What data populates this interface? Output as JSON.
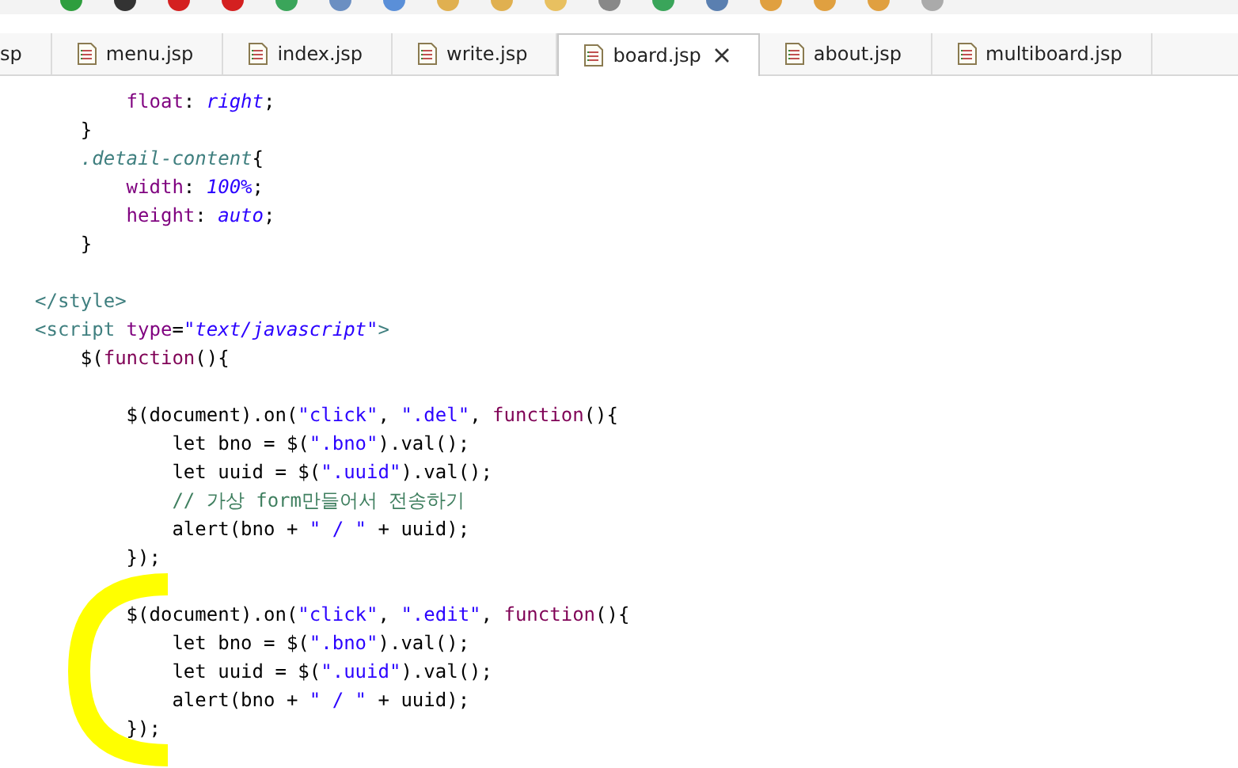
{
  "tabs": [
    {
      "label": "sp",
      "selected": false
    },
    {
      "label": "menu.jsp",
      "selected": false
    },
    {
      "label": "index.jsp",
      "selected": false
    },
    {
      "label": "write.jsp",
      "selected": false
    },
    {
      "label": "board.jsp",
      "selected": true
    },
    {
      "label": "about.jsp",
      "selected": false
    },
    {
      "label": "multiboard.jsp",
      "selected": false
    }
  ],
  "code_lines": [
    {
      "kind": "code",
      "tokens": [
        {
          "kind": "property",
          "text": "        float"
        },
        {
          "kind": "plain",
          "text": ": "
        },
        {
          "kind": "value",
          "text": "right"
        },
        {
          "kind": "plain",
          "text": ";"
        }
      ]
    },
    {
      "kind": "code",
      "tokens": [
        {
          "kind": "plain",
          "text": "    }"
        }
      ]
    },
    {
      "kind": "code",
      "tokens": [
        {
          "kind": "selector",
          "text": "    .detail-content"
        },
        {
          "kind": "plain",
          "text": "{"
        }
      ]
    },
    {
      "kind": "code",
      "tokens": [
        {
          "kind": "property",
          "text": "        width"
        },
        {
          "kind": "plain",
          "text": ": "
        },
        {
          "kind": "value",
          "text": "100%"
        },
        {
          "kind": "plain",
          "text": ";"
        }
      ]
    },
    {
      "kind": "code",
      "tokens": [
        {
          "kind": "property",
          "text": "        height"
        },
        {
          "kind": "plain",
          "text": ": "
        },
        {
          "kind": "value",
          "text": "auto"
        },
        {
          "kind": "plain",
          "text": ";"
        }
      ]
    },
    {
      "kind": "code",
      "tokens": [
        {
          "kind": "plain",
          "text": "    }"
        }
      ]
    },
    {
      "kind": "blank"
    },
    {
      "kind": "code",
      "tokens": [
        {
          "kind": "tag",
          "text": "</style>"
        }
      ]
    },
    {
      "kind": "code",
      "tokens": [
        {
          "kind": "tag",
          "text": "<script "
        },
        {
          "kind": "attribute",
          "text": "type"
        },
        {
          "kind": "plain",
          "text": "="
        },
        {
          "kind": "value",
          "text": "\"text/javascript\""
        },
        {
          "kind": "tag",
          "text": ">"
        }
      ]
    },
    {
      "kind": "code",
      "tokens": [
        {
          "kind": "plain",
          "text": "    $("
        },
        {
          "kind": "keyword",
          "text": "function"
        },
        {
          "kind": "plain",
          "text": "(){"
        }
      ]
    },
    {
      "kind": "blank"
    },
    {
      "kind": "code",
      "tokens": [
        {
          "kind": "plain",
          "text": "        $(document).on("
        },
        {
          "kind": "string",
          "text": "\"click\""
        },
        {
          "kind": "plain",
          "text": ", "
        },
        {
          "kind": "string",
          "text": "\".del\""
        },
        {
          "kind": "plain",
          "text": ", "
        },
        {
          "kind": "keyword",
          "text": "function"
        },
        {
          "kind": "plain",
          "text": "(){"
        }
      ]
    },
    {
      "kind": "code",
      "tokens": [
        {
          "kind": "plain",
          "text": "            let bno = $("
        },
        {
          "kind": "string",
          "text": "\".bno\""
        },
        {
          "kind": "plain",
          "text": ").val();"
        }
      ]
    },
    {
      "kind": "code",
      "tokens": [
        {
          "kind": "plain",
          "text": "            let uuid = $("
        },
        {
          "kind": "string",
          "text": "\".uuid\""
        },
        {
          "kind": "plain",
          "text": ").val();"
        }
      ]
    },
    {
      "kind": "code",
      "tokens": [
        {
          "kind": "comment",
          "text": "            // 가상 form만들어서 전송하기"
        }
      ]
    },
    {
      "kind": "code",
      "tokens": [
        {
          "kind": "plain",
          "text": "            alert(bno + "
        },
        {
          "kind": "string",
          "text": "\" / \""
        },
        {
          "kind": "plain",
          "text": " + uuid);"
        }
      ]
    },
    {
      "kind": "code",
      "tokens": [
        {
          "kind": "plain",
          "text": "        });"
        }
      ]
    },
    {
      "kind": "blank"
    },
    {
      "kind": "code",
      "tokens": [
        {
          "kind": "plain",
          "text": "        $(document).on("
        },
        {
          "kind": "string",
          "text": "\"click\""
        },
        {
          "kind": "plain",
          "text": ", "
        },
        {
          "kind": "string",
          "text": "\".edit\""
        },
        {
          "kind": "plain",
          "text": ", "
        },
        {
          "kind": "keyword",
          "text": "function"
        },
        {
          "kind": "plain",
          "text": "(){"
        }
      ]
    },
    {
      "kind": "code",
      "tokens": [
        {
          "kind": "plain",
          "text": "            let bno = $("
        },
        {
          "kind": "string",
          "text": "\".bno\""
        },
        {
          "kind": "plain",
          "text": ").val();"
        }
      ]
    },
    {
      "kind": "code",
      "tokens": [
        {
          "kind": "plain",
          "text": "            let uuid = $("
        },
        {
          "kind": "string",
          "text": "\".uuid\""
        },
        {
          "kind": "plain",
          "text": ").val();"
        }
      ]
    },
    {
      "kind": "code",
      "tokens": [
        {
          "kind": "plain",
          "text": "            alert(bno + "
        },
        {
          "kind": "string",
          "text": "\" / \""
        },
        {
          "kind": "plain",
          "text": " + uuid);"
        }
      ]
    },
    {
      "kind": "code",
      "tokens": [
        {
          "kind": "plain",
          "text": "        });"
        }
      ]
    }
  ]
}
